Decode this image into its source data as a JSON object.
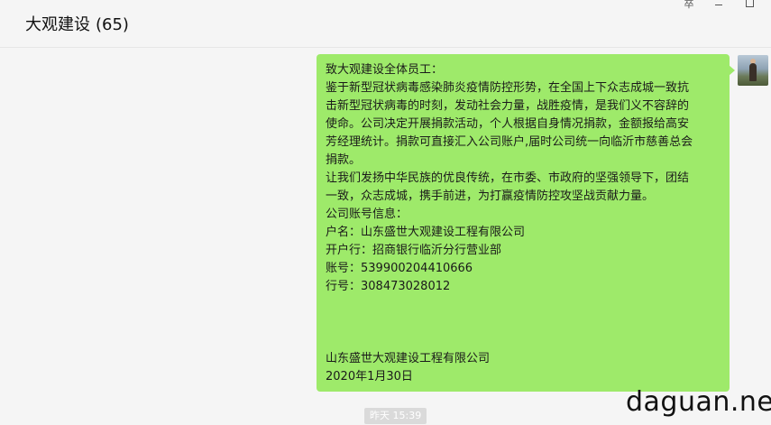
{
  "header": {
    "title": "大观建设",
    "member_count": "(65)"
  },
  "window_controls": {
    "pin_glyph": "卒",
    "minimize_icon": "minimize-icon",
    "maximize_icon": "maximize-icon"
  },
  "message": {
    "lines": [
      "致大观建设全体员工：",
      "鉴于新型冠状病毒感染肺炎疫情防控形势，在全国上下众志成城一致抗",
      "击新型冠状病毒的时刻，发动社会力量，战胜疫情，是我们义不容辞的",
      "使命。公司决定开展捐款活动，个人根据自身情况捐款，金额报给高安",
      "芳经理统计。捐款可直接汇入公司账户,届时公司统一向临沂市慈善总会",
      "捐款。",
      "让我们发扬中华民族的优良传统，在市委、市政府的坚强领导下，团结",
      "一致，众志成城，携手前进，为打赢疫情防控攻坚战贡献力量。",
      "公司账号信息：",
      "户名：山东盛世大观建设工程有限公司",
      "开户行：招商银行临沂分行营业部",
      "账号：539900204410666",
      "行号：308473028012",
      "",
      "",
      "",
      "山东盛世大观建设工程有限公司",
      "2020年1月30日"
    ],
    "bubble_color": "#9eea6a"
  },
  "timestamp": "昨天 15:39",
  "watermark": "daguan.net"
}
